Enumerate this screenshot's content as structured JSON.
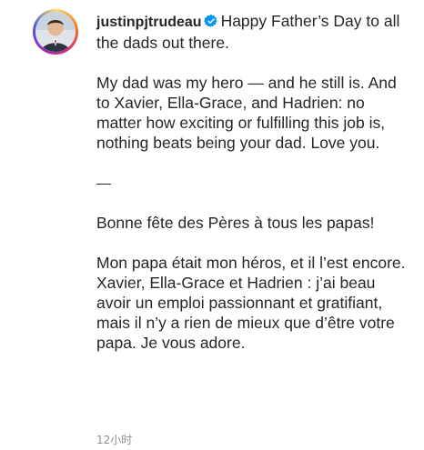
{
  "post": {
    "username": "justinpjtrudeau",
    "verified_icon": "verified-badge-icon",
    "caption": {
      "line1": "Happy Father’s Day to all the dads out there.",
      "p2": "My dad was my hero — and he still is. And to Xavier, Ella-Grace, and Hadrien: no matter how exciting or fulfilling this job is, nothing beats being your dad. Love you.",
      "separator": "—",
      "p4": "Bonne fête des Pères à tous les papas!",
      "p5": "Mon papa était mon héros, et il l’est encore. Xavier, Ella-Grace et Hadrien : j’ai beau avoir un emploi passionnant et gratifiant, mais il n’y a rien de mieux que d’être votre papa. Je vous adore."
    },
    "timestamp": "12小时"
  },
  "colors": {
    "text": "#262626",
    "muted": "#8e8e8e",
    "verified": "#0095f6"
  }
}
